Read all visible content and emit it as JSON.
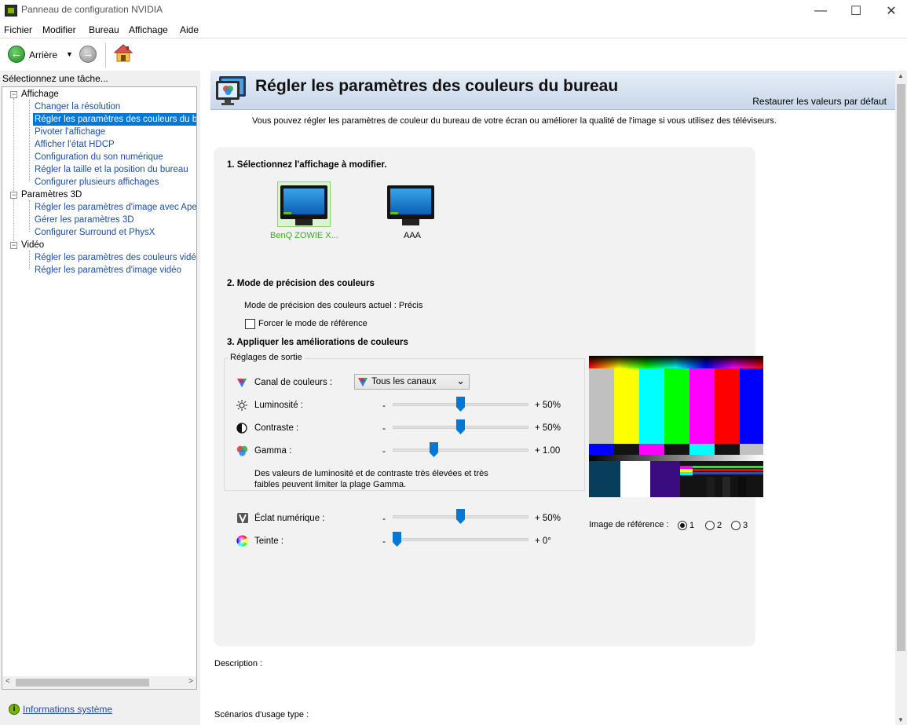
{
  "window": {
    "title": "Panneau de configuration NVIDIA",
    "controls": {
      "minimize": "—",
      "maximize": "☐",
      "close": "✕"
    }
  },
  "menu": [
    "Fichier",
    "Modifier",
    "Bureau",
    "Affichage",
    "Aide"
  ],
  "toolbar": {
    "back_label": "Arrière",
    "dropdown": "▼",
    "back_glyph": "←",
    "forward_glyph": "→"
  },
  "sidebar": {
    "task_label": "Sélectionnez une tâche...",
    "tree": [
      {
        "label": "Affichage",
        "expander": "−",
        "children": [
          {
            "label": "Changer la résolution"
          },
          {
            "label": "Régler les paramètres des couleurs du bureau",
            "selected": true
          },
          {
            "label": "Pivoter l'affichage"
          },
          {
            "label": "Afficher l'état HDCP"
          },
          {
            "label": "Configuration du son numérique"
          },
          {
            "label": "Régler la taille et la position du bureau"
          },
          {
            "label": "Configurer plusieurs affichages"
          }
        ]
      },
      {
        "label": "Paramètres 3D",
        "expander": "−",
        "children": [
          {
            "label": "Régler les paramètres d'image avec Aperçu"
          },
          {
            "label": "Gérer les paramètres 3D"
          },
          {
            "label": "Configurer Surround et PhysX"
          }
        ]
      },
      {
        "label": "Vidéo",
        "expander": "−",
        "children": [
          {
            "label": "Régler les paramètres des couleurs vidéo"
          },
          {
            "label": "Régler les paramètres d'image vidéo"
          }
        ]
      }
    ],
    "scroll_left": "<",
    "scroll_right": ">",
    "system_info_icon": "i",
    "system_info_link": "Informations système"
  },
  "page": {
    "title": "Régler les paramètres des couleurs du bureau",
    "restore_link": "Restaurer les valeurs par défaut",
    "intro": "Vous pouvez régler les paramètres de couleur du bureau de votre écran ou améliorer la qualité de l'image si vous utilisez des téléviseurs.",
    "section1": {
      "heading": "1. Sélectionnez l'affichage à modifier.",
      "displays": [
        {
          "name": "BenQ ZOWIE X...",
          "selected": true
        },
        {
          "name": "AAA",
          "selected": false
        }
      ]
    },
    "section2": {
      "heading": "2. Mode de précision des couleurs",
      "current_mode": "Mode de précision des couleurs actuel : Précis",
      "force_reference_label": "Forcer le mode de référence",
      "force_reference_checked": false
    },
    "section3": {
      "heading": "3. Appliquer les améliorations de couleurs",
      "output_group": "Réglages de sortie",
      "channel_label": "Canal de couleurs :",
      "channel_value": "Tous les canaux",
      "channel_arrow": "⌄",
      "sliders": [
        {
          "label": "Luminosité :",
          "minus": "-",
          "value": "+ 50%",
          "level": 0.5
        },
        {
          "label": "Contraste :",
          "minus": "-",
          "value": "+ 50%",
          "level": 0.5
        },
        {
          "label": "Gamma :",
          "minus": "-",
          "value": "+ 1.00",
          "level": 0.29
        }
      ],
      "note_line1": "Des valeurs de luminosité et de contraste très élevées et très",
      "note_line2": "faibles peuvent limiter la plage Gamma.",
      "extra_sliders": [
        {
          "label": "Éclat numérique :",
          "minus": "-",
          "value": "+ 50%",
          "level": 0.5
        },
        {
          "label": "Teinte :",
          "minus": "-",
          "value": "+ 0°",
          "level": 0.0
        }
      ],
      "reference_label": "Image de référence :",
      "reference_options": [
        "1",
        "2",
        "3"
      ],
      "reference_selected": "1"
    },
    "description_label": "Description :",
    "scenarios_label": "Scénarios d'usage type :"
  },
  "scroll_glyphs": {
    "up": "▲",
    "down": "▼"
  },
  "colors": {
    "nvidia_green": "#76b900",
    "selection_blue": "#0078d7",
    "link_blue": "#1c4fa5"
  }
}
